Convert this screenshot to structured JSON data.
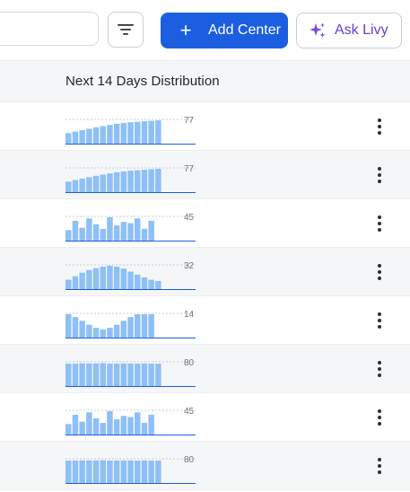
{
  "toolbar": {
    "add_label": "Add Center",
    "ask_label": "Ask Livy",
    "icons": {
      "filter": "filter-icon",
      "add": "plus-icon",
      "ask": "sparkle-icon"
    },
    "colors": {
      "primary": "#1b5fe0",
      "ai_accent": "#6a3fc8"
    }
  },
  "table": {
    "column_title": "Next 14 Days Distribution",
    "chart_colors": {
      "bar": "#8ec0f7",
      "baseline": "#1b5fe0",
      "guide": "#b7bdc6",
      "label": "#6b7280"
    },
    "rows": [
      {
        "value_label": "77",
        "bars": [
          0.45,
          0.52,
          0.58,
          0.64,
          0.7,
          0.75,
          0.8,
          0.85,
          0.89,
          0.92,
          0.94,
          0.96,
          0.98,
          1.0
        ]
      },
      {
        "value_label": "77",
        "bars": [
          0.45,
          0.52,
          0.58,
          0.64,
          0.7,
          0.75,
          0.8,
          0.85,
          0.89,
          0.92,
          0.94,
          0.96,
          0.98,
          1.0
        ]
      },
      {
        "value_label": "45",
        "bars": [
          0.45,
          0.85,
          0.55,
          0.95,
          0.7,
          0.5,
          1.0,
          0.65,
          0.8,
          0.75,
          0.95,
          0.5,
          0.85,
          0.0
        ]
      },
      {
        "value_label": "32",
        "bars": [
          0.4,
          0.55,
          0.7,
          0.82,
          0.9,
          0.96,
          1.0,
          0.96,
          0.88,
          0.75,
          0.62,
          0.5,
          0.4,
          0.35
        ]
      },
      {
        "value_label": "14",
        "bars": [
          1.0,
          0.88,
          0.72,
          0.55,
          0.42,
          0.35,
          0.42,
          0.55,
          0.72,
          0.88,
          1.0,
          1.0,
          1.0,
          0.0
        ]
      },
      {
        "value_label": "80",
        "bars": [
          0.96,
          0.96,
          0.97,
          0.97,
          0.97,
          0.98,
          0.96,
          0.96,
          0.97,
          0.97,
          0.96,
          0.97,
          0.96,
          0.96
        ]
      },
      {
        "value_label": "45",
        "bars": [
          0.45,
          0.85,
          0.55,
          0.95,
          0.7,
          0.5,
          1.0,
          0.65,
          0.8,
          0.75,
          0.95,
          0.5,
          0.85,
          0.0
        ]
      },
      {
        "value_label": "80",
        "bars": [
          0.96,
          0.96,
          0.97,
          0.97,
          0.97,
          0.98,
          0.96,
          0.96,
          0.97,
          0.97,
          0.96,
          0.97,
          0.96,
          0.96
        ]
      }
    ],
    "row_action_icon": "more-vertical-icon"
  }
}
